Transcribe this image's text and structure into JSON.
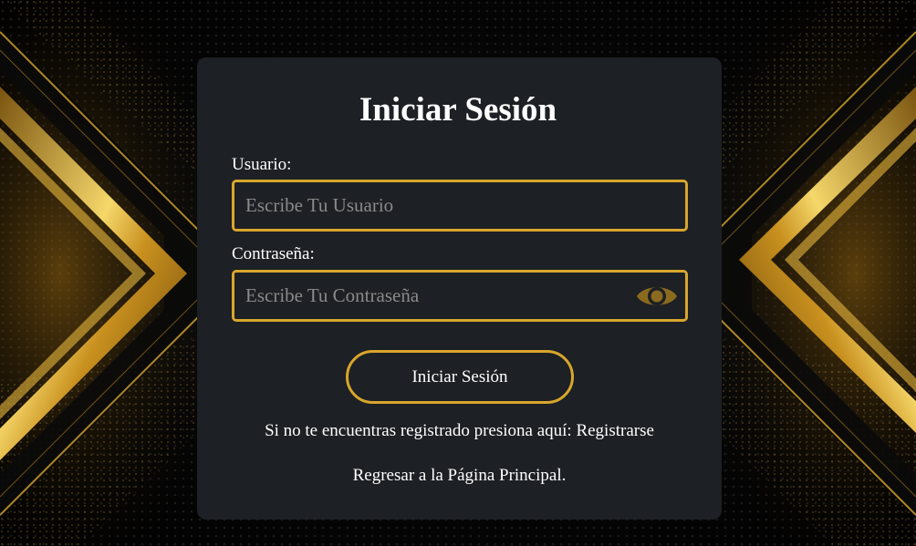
{
  "login": {
    "title": "Iniciar Sesión",
    "username_label": "Usuario:",
    "username_placeholder": "Escribe Tu Usuario",
    "username_value": "",
    "password_label": "Contraseña:",
    "password_placeholder": "Escribe Tu Contraseña",
    "password_value": "",
    "toggle_icon": "eye-icon",
    "submit_label": "Iniciar Sesión",
    "register_prompt": "Si no te encuentras registrado presiona aquí: ",
    "register_link": "Registrarse",
    "home_link": "Regresar a la Página Principal."
  },
  "colors": {
    "accent": "#d8a62c",
    "card_background": "#1d2024",
    "page_background": "#000000",
    "text": "#ffffff",
    "eye_icon": "#8a6a1e"
  }
}
